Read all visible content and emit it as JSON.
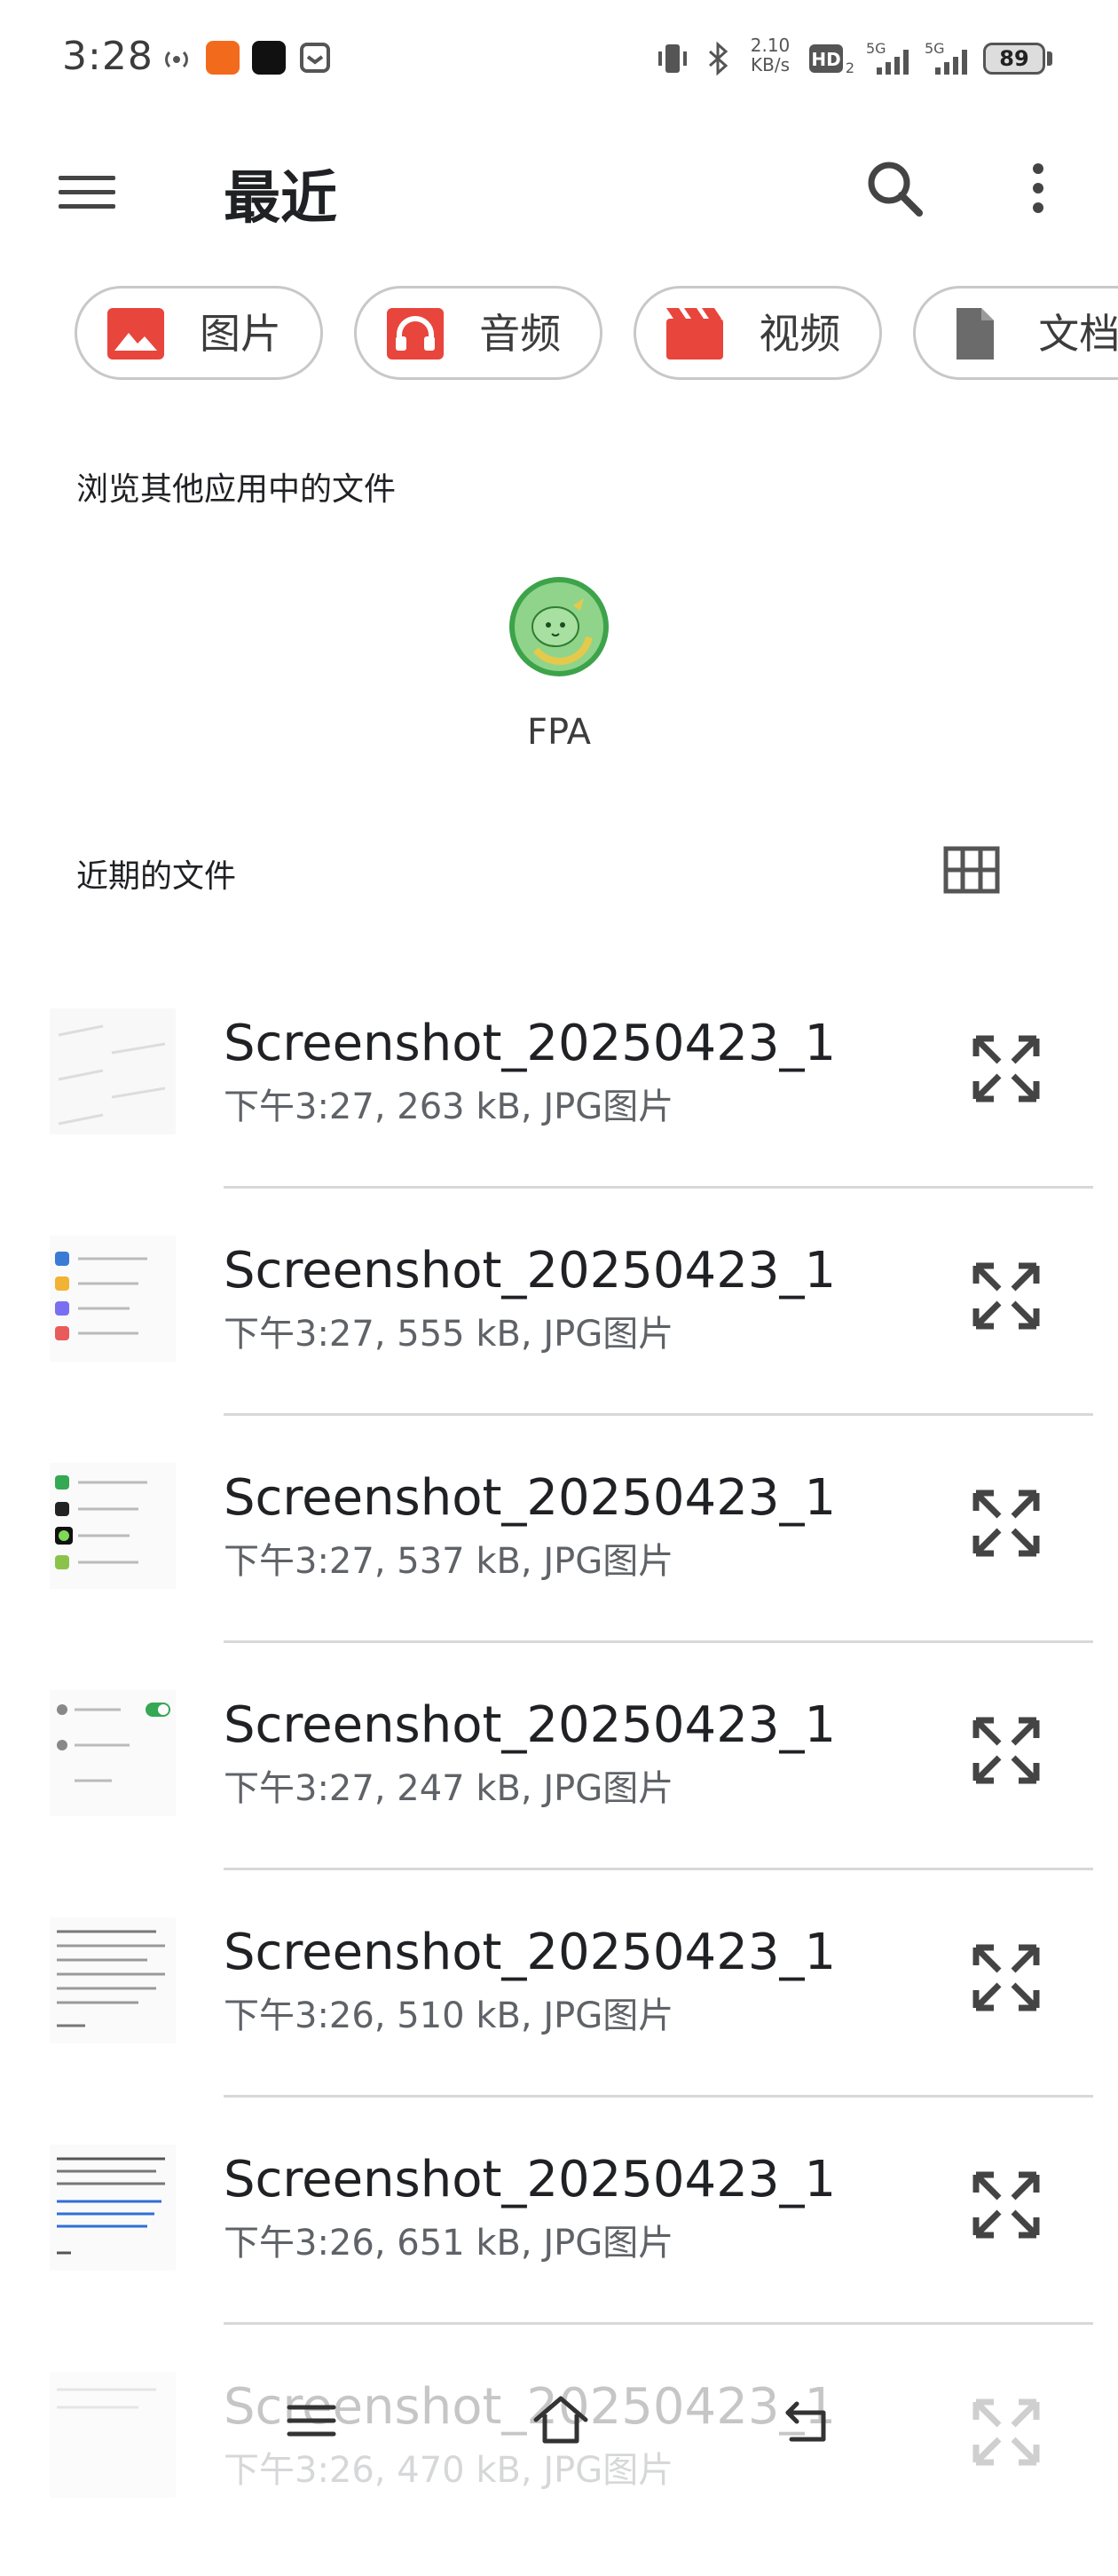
{
  "status_bar": {
    "time": "3:28",
    "speed": "2.10 KB/s",
    "hd_label": "HD",
    "network_1": "5G",
    "network_2": "5G",
    "battery": "89"
  },
  "app_bar": {
    "title": "最近",
    "menu_icon": "hamburger-menu-icon",
    "search_icon": "search-icon",
    "more_icon": "more-vert-icon"
  },
  "chips": [
    {
      "label": "图片",
      "icon": "image-icon",
      "color": "#e8453c"
    },
    {
      "label": "音频",
      "icon": "headphones-icon",
      "color": "#e8453c"
    },
    {
      "label": "视频",
      "icon": "movie-icon",
      "color": "#e8453c"
    },
    {
      "label": "文档",
      "icon": "document-icon",
      "color": "#6b6b6b"
    }
  ],
  "browse": {
    "heading": "浏览其他应用中的文件",
    "apps": [
      {
        "label": "FPA"
      }
    ]
  },
  "recent": {
    "heading": "近期的文件",
    "view_toggle_icon": "grid-view-icon",
    "files": [
      {
        "name": "Screenshot_20250423_1…",
        "meta": "下午3:27, 263 kB, JPG图片"
      },
      {
        "name": "Screenshot_20250423_1…",
        "meta": "下午3:27, 555 kB, JPG图片"
      },
      {
        "name": "Screenshot_20250423_1…",
        "meta": "下午3:27, 537 kB, JPG图片"
      },
      {
        "name": "Screenshot_20250423_1…",
        "meta": "下午3:27, 247 kB, JPG图片"
      },
      {
        "name": "Screenshot_20250423_1…",
        "meta": "下午3:26, 510 kB, JPG图片"
      },
      {
        "name": "Screenshot_20250423_1…",
        "meta": "下午3:26, 651 kB, JPG图片"
      },
      {
        "name": "Screenshot_20250423_1…",
        "meta": "下午3:26, 470 kB, JPG图片"
      }
    ]
  },
  "nav_bar": {
    "recents_icon": "recents-icon",
    "home_icon": "home-icon",
    "back_icon": "back-icon"
  }
}
